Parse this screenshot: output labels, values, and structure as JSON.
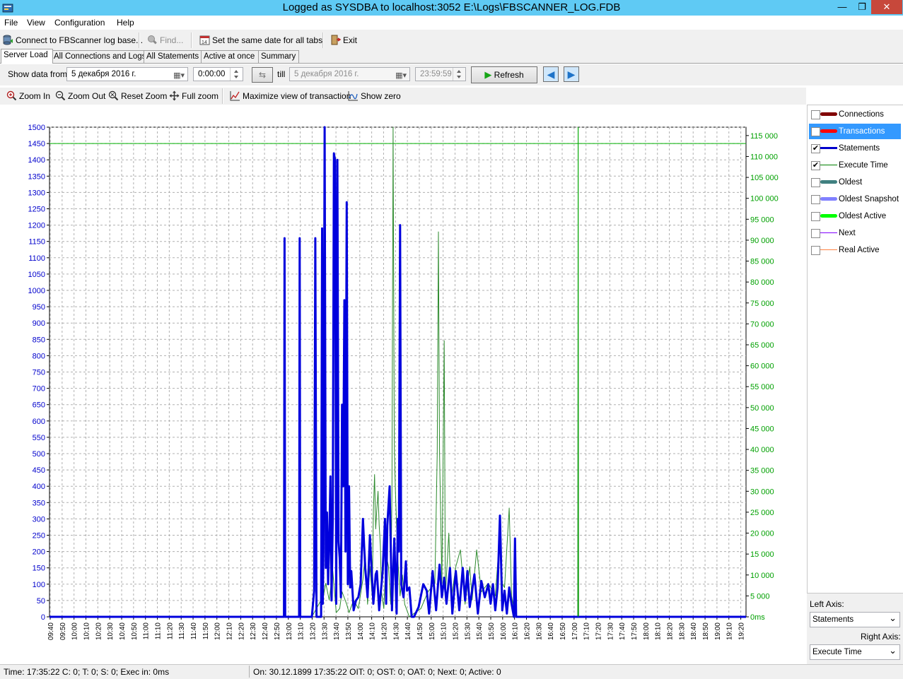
{
  "window": {
    "title": "Logged as SYSDBA to localhost:3052 E:\\Logs\\FBSCANNER_LOG.FDB"
  },
  "menu": [
    "File",
    "View",
    "Configuration",
    "Help"
  ],
  "toolbar": {
    "connect": "Connect to FBScanner log base...",
    "find": "Find...",
    "same_date": "Set the same date for all tabs",
    "exit": "Exit"
  },
  "tabs": [
    "Server Load",
    "All Connections and Logs",
    "All Statements",
    "Active at once",
    "Summary"
  ],
  "filter": {
    "show_from_label": "Show data from",
    "from_date": "5 декабря 2016 г.",
    "from_time": "0:00:00",
    "till_label": "till",
    "till_date": "5 декабря 2016 г.",
    "till_time": "23:59:59",
    "refresh": "Refresh"
  },
  "zoom_toolbar": {
    "zoom_in": "Zoom In",
    "zoom_out": "Zoom Out",
    "reset_zoom": "Reset Zoom",
    "full_zoom": "Full zoom",
    "maximize": "Maximize view of transaction",
    "show_zero": "Show zero"
  },
  "legend": [
    {
      "label": "Connections",
      "checked": false,
      "color": "#800000",
      "thick": true
    },
    {
      "label": "Transactions",
      "checked": false,
      "color": "#ff0000",
      "thick": true,
      "selected": true
    },
    {
      "label": "Statements",
      "checked": true,
      "color": "#0000cc",
      "thick": false
    },
    {
      "label": "Execute Time",
      "checked": true,
      "color": "#008000",
      "thick": false
    },
    {
      "label": "Oldest",
      "checked": false,
      "color": "#408080",
      "thick": true
    },
    {
      "label": "Oldest Snapshot",
      "checked": false,
      "color": "#8080ff",
      "thick": true
    },
    {
      "label": "Oldest Active",
      "checked": false,
      "color": "#00ff00",
      "thick": true
    },
    {
      "label": "Next",
      "checked": false,
      "color": "#8000ff",
      "thick": false
    },
    {
      "label": "Real Active",
      "checked": false,
      "color": "#ff8040",
      "thick": false
    }
  ],
  "axis_select": {
    "left_label": "Left Axis:",
    "left_value": "Statements",
    "right_label": "Right Axis:",
    "right_value": "Execute Time"
  },
  "status": {
    "left": "Time: 17:35:22 C: 0; T: 0; S: 0; Exec in: 0ms",
    "right": "On: 30.12.1899 17:35:22 OIT: 0; OST: 0; OAT: 0; Next: 0; Active: 0"
  },
  "chart_data": {
    "type": "line",
    "x_ticks": [
      "09:40",
      "09:50",
      "10:00",
      "10:10",
      "10:20",
      "10:30",
      "10:40",
      "10:50",
      "11:00",
      "11:10",
      "11:20",
      "11:30",
      "11:40",
      "11:50",
      "12:00",
      "12:10",
      "12:20",
      "12:30",
      "12:40",
      "12:50",
      "13:00",
      "13:10",
      "13:20",
      "13:30",
      "13:40",
      "13:50",
      "14:00",
      "14:10",
      "14:20",
      "14:30",
      "14:40",
      "14:50",
      "15:00",
      "15:10",
      "15:20",
      "15:30",
      "15:40",
      "15:50",
      "16:00",
      "16:10",
      "16:20",
      "16:30",
      "16:40",
      "16:50",
      "17:00",
      "17:10",
      "17:20",
      "17:30",
      "17:40",
      "17:50",
      "18:00",
      "18:10",
      "18:20",
      "18:30",
      "18:40",
      "18:50",
      "19:00",
      "19:10",
      "19:20"
    ],
    "left_axis": {
      "min": 0,
      "max": 1500,
      "step": 50,
      "ticks": [
        "0",
        "50",
        "100",
        "150",
        "200",
        "250",
        "300",
        "350",
        "400",
        "450",
        "500",
        "550",
        "600",
        "650",
        "700",
        "750",
        "800",
        "850",
        "900",
        "950",
        "1000",
        "1050",
        "1100",
        "1150",
        "1200",
        "1250",
        "1300",
        "1350",
        "1400",
        "1450",
        "1500"
      ]
    },
    "right_axis": {
      "min": 0,
      "max": 117000,
      "ticks": [
        "0ms",
        "5 000",
        "10 000",
        "15 000",
        "20 000",
        "25 000",
        "30 000",
        "35 000",
        "40 000",
        "45 000",
        "50 000",
        "55 000",
        "60 000",
        "65 000",
        "70 000",
        "75 000",
        "80 000",
        "85 000",
        "90 000",
        "95 000",
        "100 000",
        "105 000",
        "110 000",
        "115 000"
      ]
    },
    "grid": true,
    "reference_h_left": 1450,
    "cursor_x_min": 455.4,
    "series": [
      {
        "name": "Statements",
        "axis": "left",
        "color": "#0000dd",
        "points": [
          [
            0,
            0
          ],
          [
            202,
            0
          ],
          [
            202.5,
            1160
          ],
          [
            203,
            0
          ],
          [
            215,
            0
          ],
          [
            215.5,
            1160
          ],
          [
            216,
            0
          ],
          [
            226,
            0
          ],
          [
            228,
            80
          ],
          [
            229,
            1160
          ],
          [
            230,
            0
          ],
          [
            234,
            0
          ],
          [
            234.8,
            1190
          ],
          [
            235.4,
            40
          ],
          [
            236,
            200
          ],
          [
            237,
            1500
          ],
          [
            238,
            150
          ],
          [
            239,
            320
          ],
          [
            240,
            100
          ],
          [
            241,
            230
          ],
          [
            242,
            430
          ],
          [
            243,
            50
          ],
          [
            244,
            300
          ],
          [
            245,
            1420
          ],
          [
            246,
            1400
          ],
          [
            247,
            40
          ],
          [
            248,
            1400
          ],
          [
            249,
            230
          ],
          [
            250,
            180
          ],
          [
            251,
            60
          ],
          [
            252,
            650
          ],
          [
            253,
            400
          ],
          [
            254,
            970
          ],
          [
            255,
            200
          ],
          [
            256,
            1270
          ],
          [
            257,
            100
          ],
          [
            258,
            400
          ],
          [
            259,
            90
          ],
          [
            260,
            140
          ],
          [
            262,
            20
          ],
          [
            264,
            50
          ],
          [
            266,
            60
          ],
          [
            268,
            100
          ],
          [
            270,
            300
          ],
          [
            271,
            220
          ],
          [
            272,
            150
          ],
          [
            274,
            60
          ],
          [
            276,
            250
          ],
          [
            277,
            180
          ],
          [
            279,
            40
          ],
          [
            281,
            130
          ],
          [
            282,
            140
          ],
          [
            284,
            20
          ],
          [
            287,
            140
          ],
          [
            289,
            300
          ],
          [
            290,
            40
          ],
          [
            291,
            280
          ],
          [
            293,
            400
          ],
          [
            295,
            20
          ],
          [
            297,
            240
          ],
          [
            299,
            10
          ],
          [
            300,
            300
          ],
          [
            301,
            200
          ],
          [
            302,
            1200
          ],
          [
            303,
            100
          ],
          [
            305,
            60
          ],
          [
            307,
            170
          ],
          [
            308,
            80
          ],
          [
            310,
            90
          ],
          [
            312,
            0
          ],
          [
            314,
            0
          ],
          [
            318,
            30
          ],
          [
            322,
            100
          ],
          [
            325,
            80
          ],
          [
            327,
            10
          ],
          [
            330,
            140
          ],
          [
            333,
            20
          ],
          [
            336,
            160
          ],
          [
            338,
            60
          ],
          [
            340,
            120
          ],
          [
            342,
            40
          ],
          [
            345,
            150
          ],
          [
            347,
            10
          ],
          [
            350,
            140
          ],
          [
            353,
            20
          ],
          [
            356,
            150
          ],
          [
            358,
            50
          ],
          [
            360,
            140
          ],
          [
            362,
            30
          ],
          [
            366,
            130
          ],
          [
            369,
            10
          ],
          [
            372,
            110
          ],
          [
            375,
            60
          ],
          [
            378,
            100
          ],
          [
            380,
            40
          ],
          [
            382,
            100
          ],
          [
            384,
            20
          ],
          [
            386,
            90
          ],
          [
            388,
            310
          ],
          [
            390,
            20
          ],
          [
            392,
            80
          ],
          [
            394,
            10
          ],
          [
            396,
            90
          ],
          [
            398,
            40
          ],
          [
            400,
            0
          ],
          [
            401,
            240
          ],
          [
            402,
            0
          ],
          [
            403,
            0
          ],
          [
            430,
            0
          ],
          [
            470,
            0
          ],
          [
            520,
            0
          ],
          [
            600,
            0
          ]
        ]
      },
      {
        "name": "Execute Time",
        "axis": "right",
        "color": "#2e8b2e",
        "points": [
          [
            0,
            0
          ],
          [
            226,
            0
          ],
          [
            236,
            5000
          ],
          [
            238,
            8000
          ],
          [
            241,
            4000
          ],
          [
            244,
            11000
          ],
          [
            247,
            1000
          ],
          [
            250,
            2000
          ],
          [
            252,
            6000
          ],
          [
            256,
            3000
          ],
          [
            258,
            1000
          ],
          [
            262,
            4000
          ],
          [
            266,
            2000
          ],
          [
            270,
            9000
          ],
          [
            272,
            15000
          ],
          [
            274,
            3000
          ],
          [
            276,
            12000
          ],
          [
            278,
            5000
          ],
          [
            279,
            25000
          ],
          [
            280,
            34000
          ],
          [
            281,
            21000
          ],
          [
            282,
            26000
          ],
          [
            283,
            30000
          ],
          [
            284,
            22000
          ],
          [
            285,
            17000
          ],
          [
            286,
            6000
          ],
          [
            288,
            2000
          ],
          [
            290,
            15000
          ],
          [
            292,
            12000
          ],
          [
            294,
            3000
          ],
          [
            295,
            30000
          ],
          [
            296,
            117000
          ],
          [
            297,
            40000
          ],
          [
            298,
            30000
          ],
          [
            300,
            14000
          ],
          [
            302,
            5000
          ],
          [
            304,
            10000
          ],
          [
            306,
            3000
          ],
          [
            310,
            0
          ],
          [
            320,
            2000
          ],
          [
            326,
            6000
          ],
          [
            332,
            8000
          ],
          [
            334,
            39000
          ],
          [
            335,
            92000
          ],
          [
            336,
            39000
          ],
          [
            338,
            8000
          ],
          [
            340,
            66000
          ],
          [
            341,
            5000
          ],
          [
            344,
            20000
          ],
          [
            346,
            4000
          ],
          [
            350,
            12000
          ],
          [
            354,
            16000
          ],
          [
            358,
            3000
          ],
          [
            362,
            12000
          ],
          [
            364,
            4000
          ],
          [
            368,
            16000
          ],
          [
            372,
            6000
          ],
          [
            378,
            8000
          ],
          [
            384,
            5000
          ],
          [
            388,
            20000
          ],
          [
            390,
            8000
          ],
          [
            392,
            7000
          ],
          [
            396,
            26000
          ],
          [
            398,
            5000
          ],
          [
            400,
            2000
          ],
          [
            402,
            0
          ],
          [
            455,
            0
          ],
          [
            455.4,
            117000
          ],
          [
            455.8,
            0
          ],
          [
            520,
            0
          ],
          [
            600,
            0
          ]
        ]
      }
    ]
  }
}
